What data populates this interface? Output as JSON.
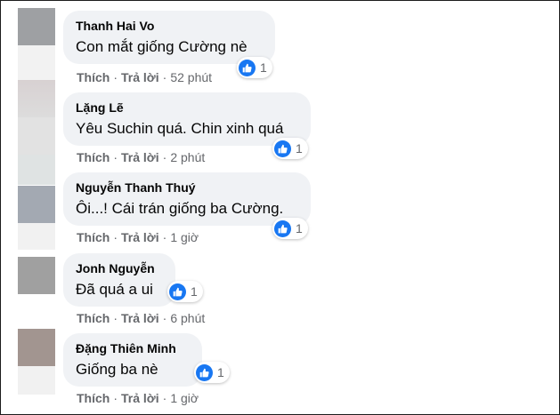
{
  "comments": [
    {
      "author": "Thanh Hai Vo",
      "text": "Con mắt giống Cường nè",
      "reaction_icon": "like-icon",
      "reaction_count": "1",
      "like_label": "Thích",
      "reply_label": "Trả lời",
      "time": "52 phút",
      "avatar_color": "#9ea0a3"
    },
    {
      "author": "Lặng Lẽ",
      "text": "Yêu Suchin quá. Chin xinh quá",
      "reaction_icon": "like-icon",
      "reaction_count": "1",
      "like_label": "Thích",
      "reply_label": "Trả lời",
      "time": "2 phút",
      "avatar_color": "#d2d0d1"
    },
    {
      "author": "Nguyễn Thanh Thuý",
      "text": "Ôi...! Cái trán giống ba Cường.",
      "reaction_icon": "like-icon",
      "reaction_count": "1",
      "like_label": "Thích",
      "reply_label": "Trả lời",
      "time": "1 giờ",
      "avatar_color": "#a3a9b2"
    },
    {
      "author": "Jonh Nguyễn",
      "text": "Đã quá a ui",
      "reaction_icon": "like-icon",
      "reaction_count": "1",
      "like_label": "Thích",
      "reply_label": "Trả lời",
      "time": "6 phút",
      "avatar_color": "#a0a0a0"
    },
    {
      "author": "Đặng Thiên Minh",
      "text": "Giống ba nè",
      "reaction_icon": "like-icon",
      "reaction_count": "1",
      "like_label": "Thích",
      "reply_label": "Trả lời",
      "time": "1 giờ",
      "avatar_color": "#a29590"
    }
  ],
  "colors": {
    "bubble": "#f0f2f5",
    "like_blue": "#1877f2",
    "meta_gray": "#65676b"
  }
}
